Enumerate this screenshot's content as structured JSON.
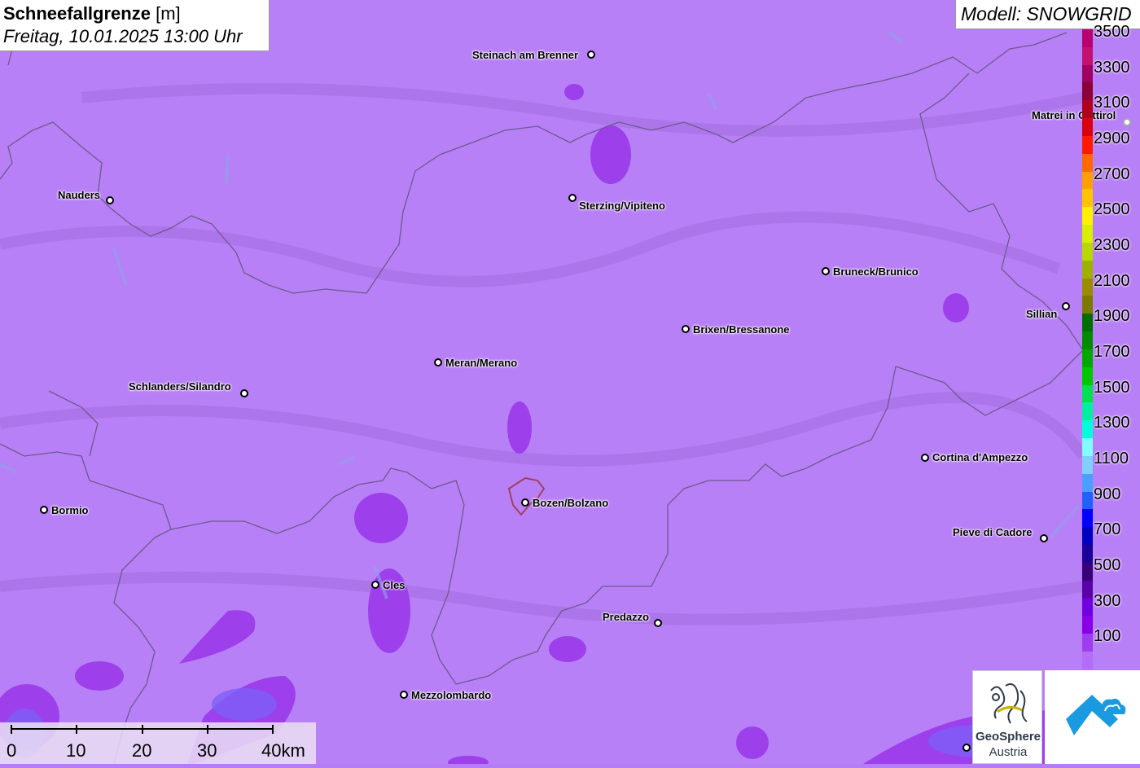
{
  "title": {
    "variable": "Schneefallgrenze",
    "unit": "[m]",
    "datetime": "Freitag, 10.01.2025 13:00 Uhr"
  },
  "model": "Modell: SNOWGRID",
  "cities": [
    {
      "name": "Steinach am Brenner"
    },
    {
      "name": "Nauders"
    },
    {
      "name": "Sterzing/Vipiteno"
    },
    {
      "name": "Matrei in Osttirol"
    },
    {
      "name": "Bruneck/Brunico"
    },
    {
      "name": "Sillian"
    },
    {
      "name": "Brixen/Bressanone"
    },
    {
      "name": "Meran/Merano"
    },
    {
      "name": "Schlanders/Silandro"
    },
    {
      "name": "Cortina d'Ampezzo"
    },
    {
      "name": "Bormio"
    },
    {
      "name": "Bozen/Bolzano"
    },
    {
      "name": "Pieve di Cadore"
    },
    {
      "name": "Cles"
    },
    {
      "name": "Predazzo"
    },
    {
      "name": "Mezzolombardo"
    }
  ],
  "legend": {
    "labels": [
      "3500",
      "3300",
      "3100",
      "2900",
      "2700",
      "2500",
      "2300",
      "2100",
      "1900",
      "1700",
      "1500",
      "1300",
      "1100",
      "900",
      "700",
      "500",
      "300",
      "100"
    ],
    "colors": [
      "#b8006e",
      "#c4106e",
      "#a00060",
      "#8c0036",
      "#b0001c",
      "#d80010",
      "#ff1a00",
      "#ff6a00",
      "#ff9f00",
      "#ffc400",
      "#fff000",
      "#d8f000",
      "#b8d800",
      "#a0b000",
      "#9a8c00",
      "#7a7a00",
      "#006e00",
      "#008c00",
      "#00a800",
      "#00c800",
      "#00e050",
      "#00f0a0",
      "#00ffd8",
      "#80ffff",
      "#80d0ff",
      "#4aa0ff",
      "#2060ff",
      "#0000ff",
      "#0000c0",
      "#1a0096",
      "#380078",
      "#5a00a8",
      "#7000e0",
      "#8800e8",
      "#9e3cf0",
      "#b46ef5"
    ]
  },
  "scalebar": {
    "labels": [
      "0",
      "10",
      "20",
      "30",
      "40km"
    ]
  },
  "logo": {
    "line1": "GeoSphere",
    "line2": "Austria"
  },
  "colors": {
    "base_fill": "#b57cf5",
    "border": "#6e5a8a",
    "low_patch": "#9a3ce8",
    "blue_patch": "#7a50f8"
  }
}
